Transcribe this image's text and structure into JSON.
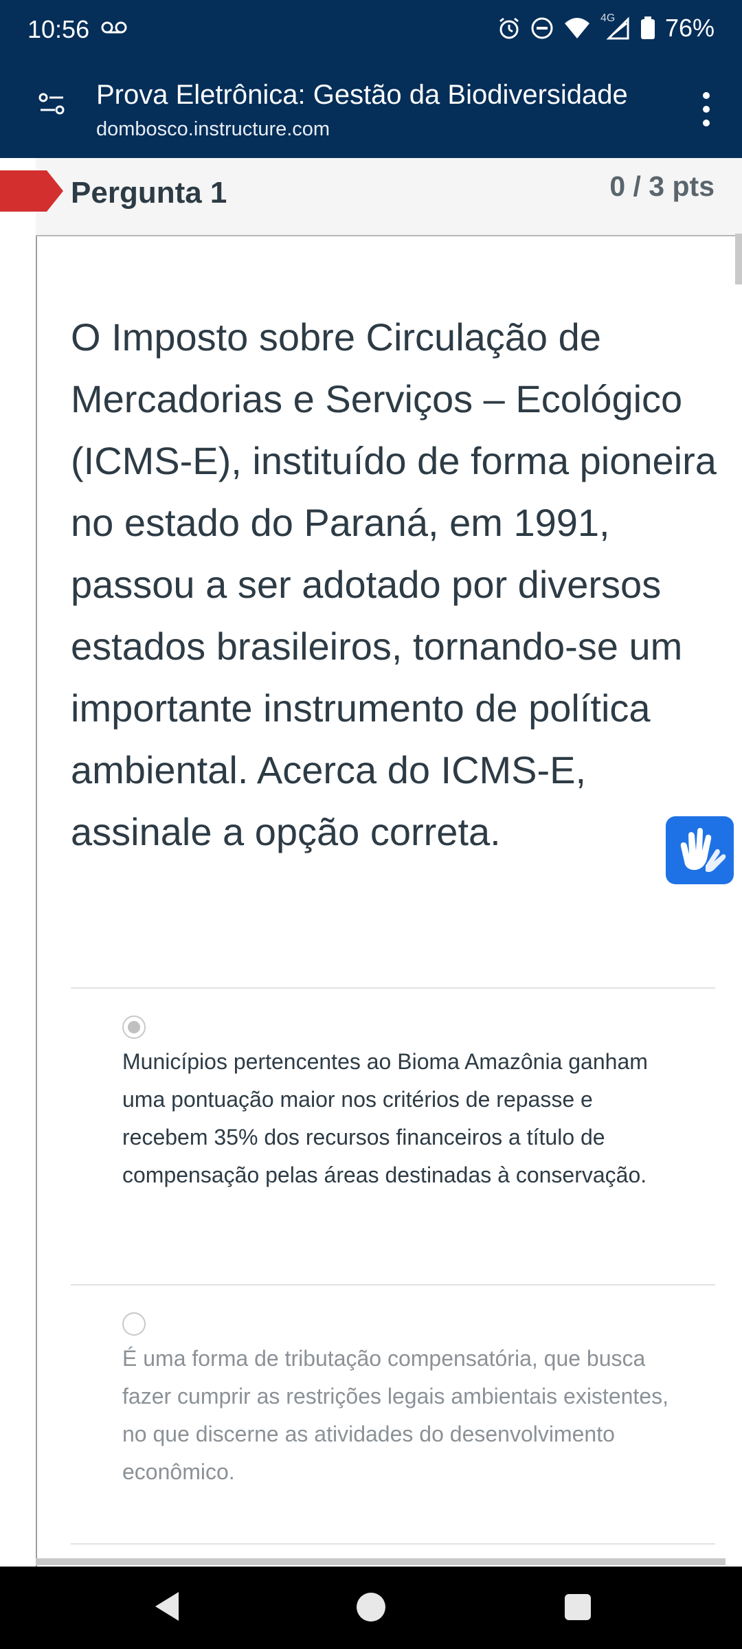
{
  "status_bar": {
    "time": "10:56",
    "network_label": "4G",
    "battery_percent": "76%",
    "icons": [
      "voicemail-icon",
      "alarm-icon",
      "do-not-disturb-icon",
      "wifi-icon",
      "signal-icon",
      "battery-icon"
    ]
  },
  "app_bar": {
    "title": "Prova Eletrônica: Gestão da Biodiversidade",
    "subtitle": "dombosco.instructure.com"
  },
  "question": {
    "title": "Pergunta 1",
    "points": "0 / 3 pts",
    "text": "O Imposto sobre Circulação de Mercadorias e Serviços – Ecológico (ICMS-E), instituído de forma pioneira no estado do Paraná, em 1991, passou a ser adotado por diversos estados brasileiros, tornando-se um importante instrumento de política ambiental. Acerca do ICMS-E, assinale a opção correta."
  },
  "answers": [
    {
      "text": "Municípios pertencentes ao Bioma Amazônia ganham uma pontuação maior nos critérios de repasse e recebem 35% dos recursos financeiros a título de compensação pelas áreas destinadas à conservação.",
      "selected": true
    },
    {
      "text": "É uma forma de tributação compensatória, que busca fazer cumprir as restrições legais ambientais existentes, no que discerne as atividades do desenvolvimento econômico.",
      "selected": false
    }
  ],
  "colors": {
    "app_bar_bg": "#052e58",
    "flag_red": "#d42f2f",
    "accessibility_blue": "#1f72e5",
    "text_dark": "#2d3b45",
    "text_dim": "#8b9196"
  }
}
